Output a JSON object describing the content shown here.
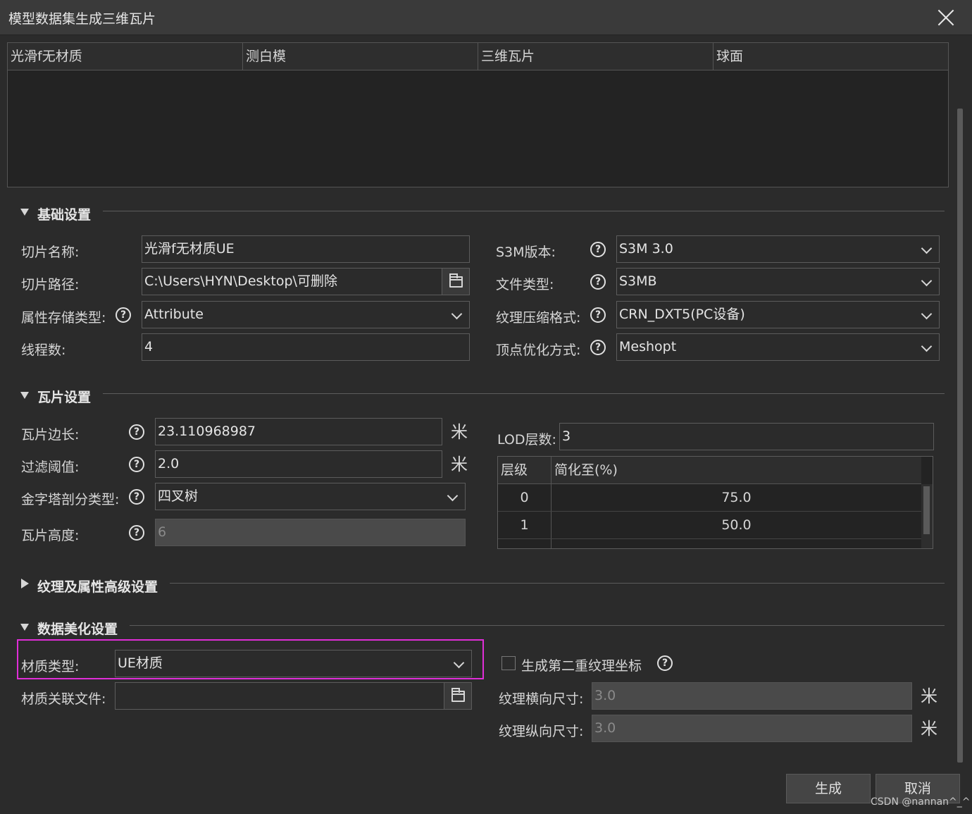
{
  "window": {
    "title": "模型数据集生成三维瓦片"
  },
  "top_table": {
    "columns": [
      "光滑f无材质",
      "测白模",
      "三维瓦片",
      "球面"
    ]
  },
  "basic": {
    "title": "基础设置",
    "slice_name_label": "切片名称:",
    "slice_name_value": "光滑f无材质UE",
    "slice_path_label": "切片路径:",
    "slice_path_value": "C:\\Users\\HYN\\Desktop\\可删除",
    "attr_storage_label": "属性存储类型:",
    "attr_storage_value": "Attribute",
    "threads_label": "线程数:",
    "threads_value": "4",
    "s3m_version_label": "S3M版本:",
    "s3m_version_value": "S3M 3.0",
    "file_type_label": "文件类型:",
    "file_type_value": "S3MB",
    "texture_compress_label": "纹理压缩格式:",
    "texture_compress_value": "CRN_DXT5(PC设备)",
    "vertex_opt_label": "顶点优化方式:",
    "vertex_opt_value": "Meshopt"
  },
  "tile": {
    "title": "瓦片设置",
    "edge_label": "瓦片边长:",
    "edge_value": "23.110968987",
    "filter_label": "过滤阈值:",
    "filter_value": "2.0",
    "pyramid_label": "金字塔剖分类型:",
    "pyramid_value": "四叉树",
    "height_label": "瓦片高度:",
    "height_value": "6",
    "lod_label": "LOD层数:",
    "lod_value": "3",
    "lod_table": {
      "col_level": "层级",
      "col_simplify": "简化至(%)",
      "rows": [
        {
          "level": "0",
          "simplify": "75.0"
        },
        {
          "level": "1",
          "simplify": "50.0"
        }
      ]
    }
  },
  "advanced": {
    "title": "纹理及属性高级设置"
  },
  "beautify": {
    "title": "数据美化设置",
    "material_type_label": "材质类型:",
    "material_type_value": "UE材质",
    "material_file_label": "材质关联文件:",
    "material_file_value": "",
    "second_uv_label": "生成第二重纹理坐标",
    "tex_h_label": "纹理横向尺寸:",
    "tex_h_value": "3.0",
    "tex_v_label": "纹理纵向尺寸:",
    "tex_v_value": "3.0"
  },
  "footer": {
    "generate": "生成",
    "cancel": "取消"
  },
  "watermark": "CSDN @nannan^_^",
  "icons": {
    "help": "?",
    "unit": "米"
  },
  "colors": {
    "background": "#2b2b2b",
    "highlight": "#e02ed8"
  }
}
